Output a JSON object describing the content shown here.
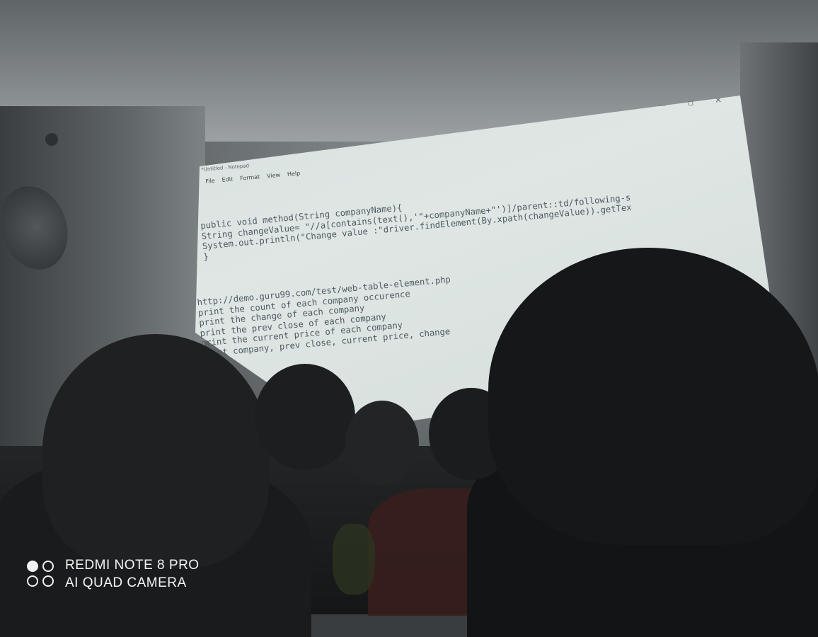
{
  "notepad": {
    "title": "*Untitled - Notepad",
    "menu": [
      "File",
      "Edit",
      "Format",
      "View",
      "Help"
    ],
    "controls": {
      "minimize_icon": "—",
      "maximize_icon": "▫",
      "close_icon": "✕"
    }
  },
  "code_lines": [
    "public void method(String companyName){",
    "String changeValue= \"//a[contains(text(),'\"+companyName+\"')]/parent::td/following-s",
    "System.out.println(\"Change value :\"driver.findElement(By.xpath(changeValue)).getTex",
    "}"
  ],
  "notes_lines": [
    "http://demo.guru99.com/test/web-table-element.php",
    "print the count of each company occurence",
    "print the change of each company",
    "print the prev close of each company",
    "print the current price of each company",
    "print company, prev close, current price, change"
  ],
  "watermark": {
    "line1": "REDMI NOTE 8 PRO",
    "line2": "AI QUAD CAMERA"
  }
}
